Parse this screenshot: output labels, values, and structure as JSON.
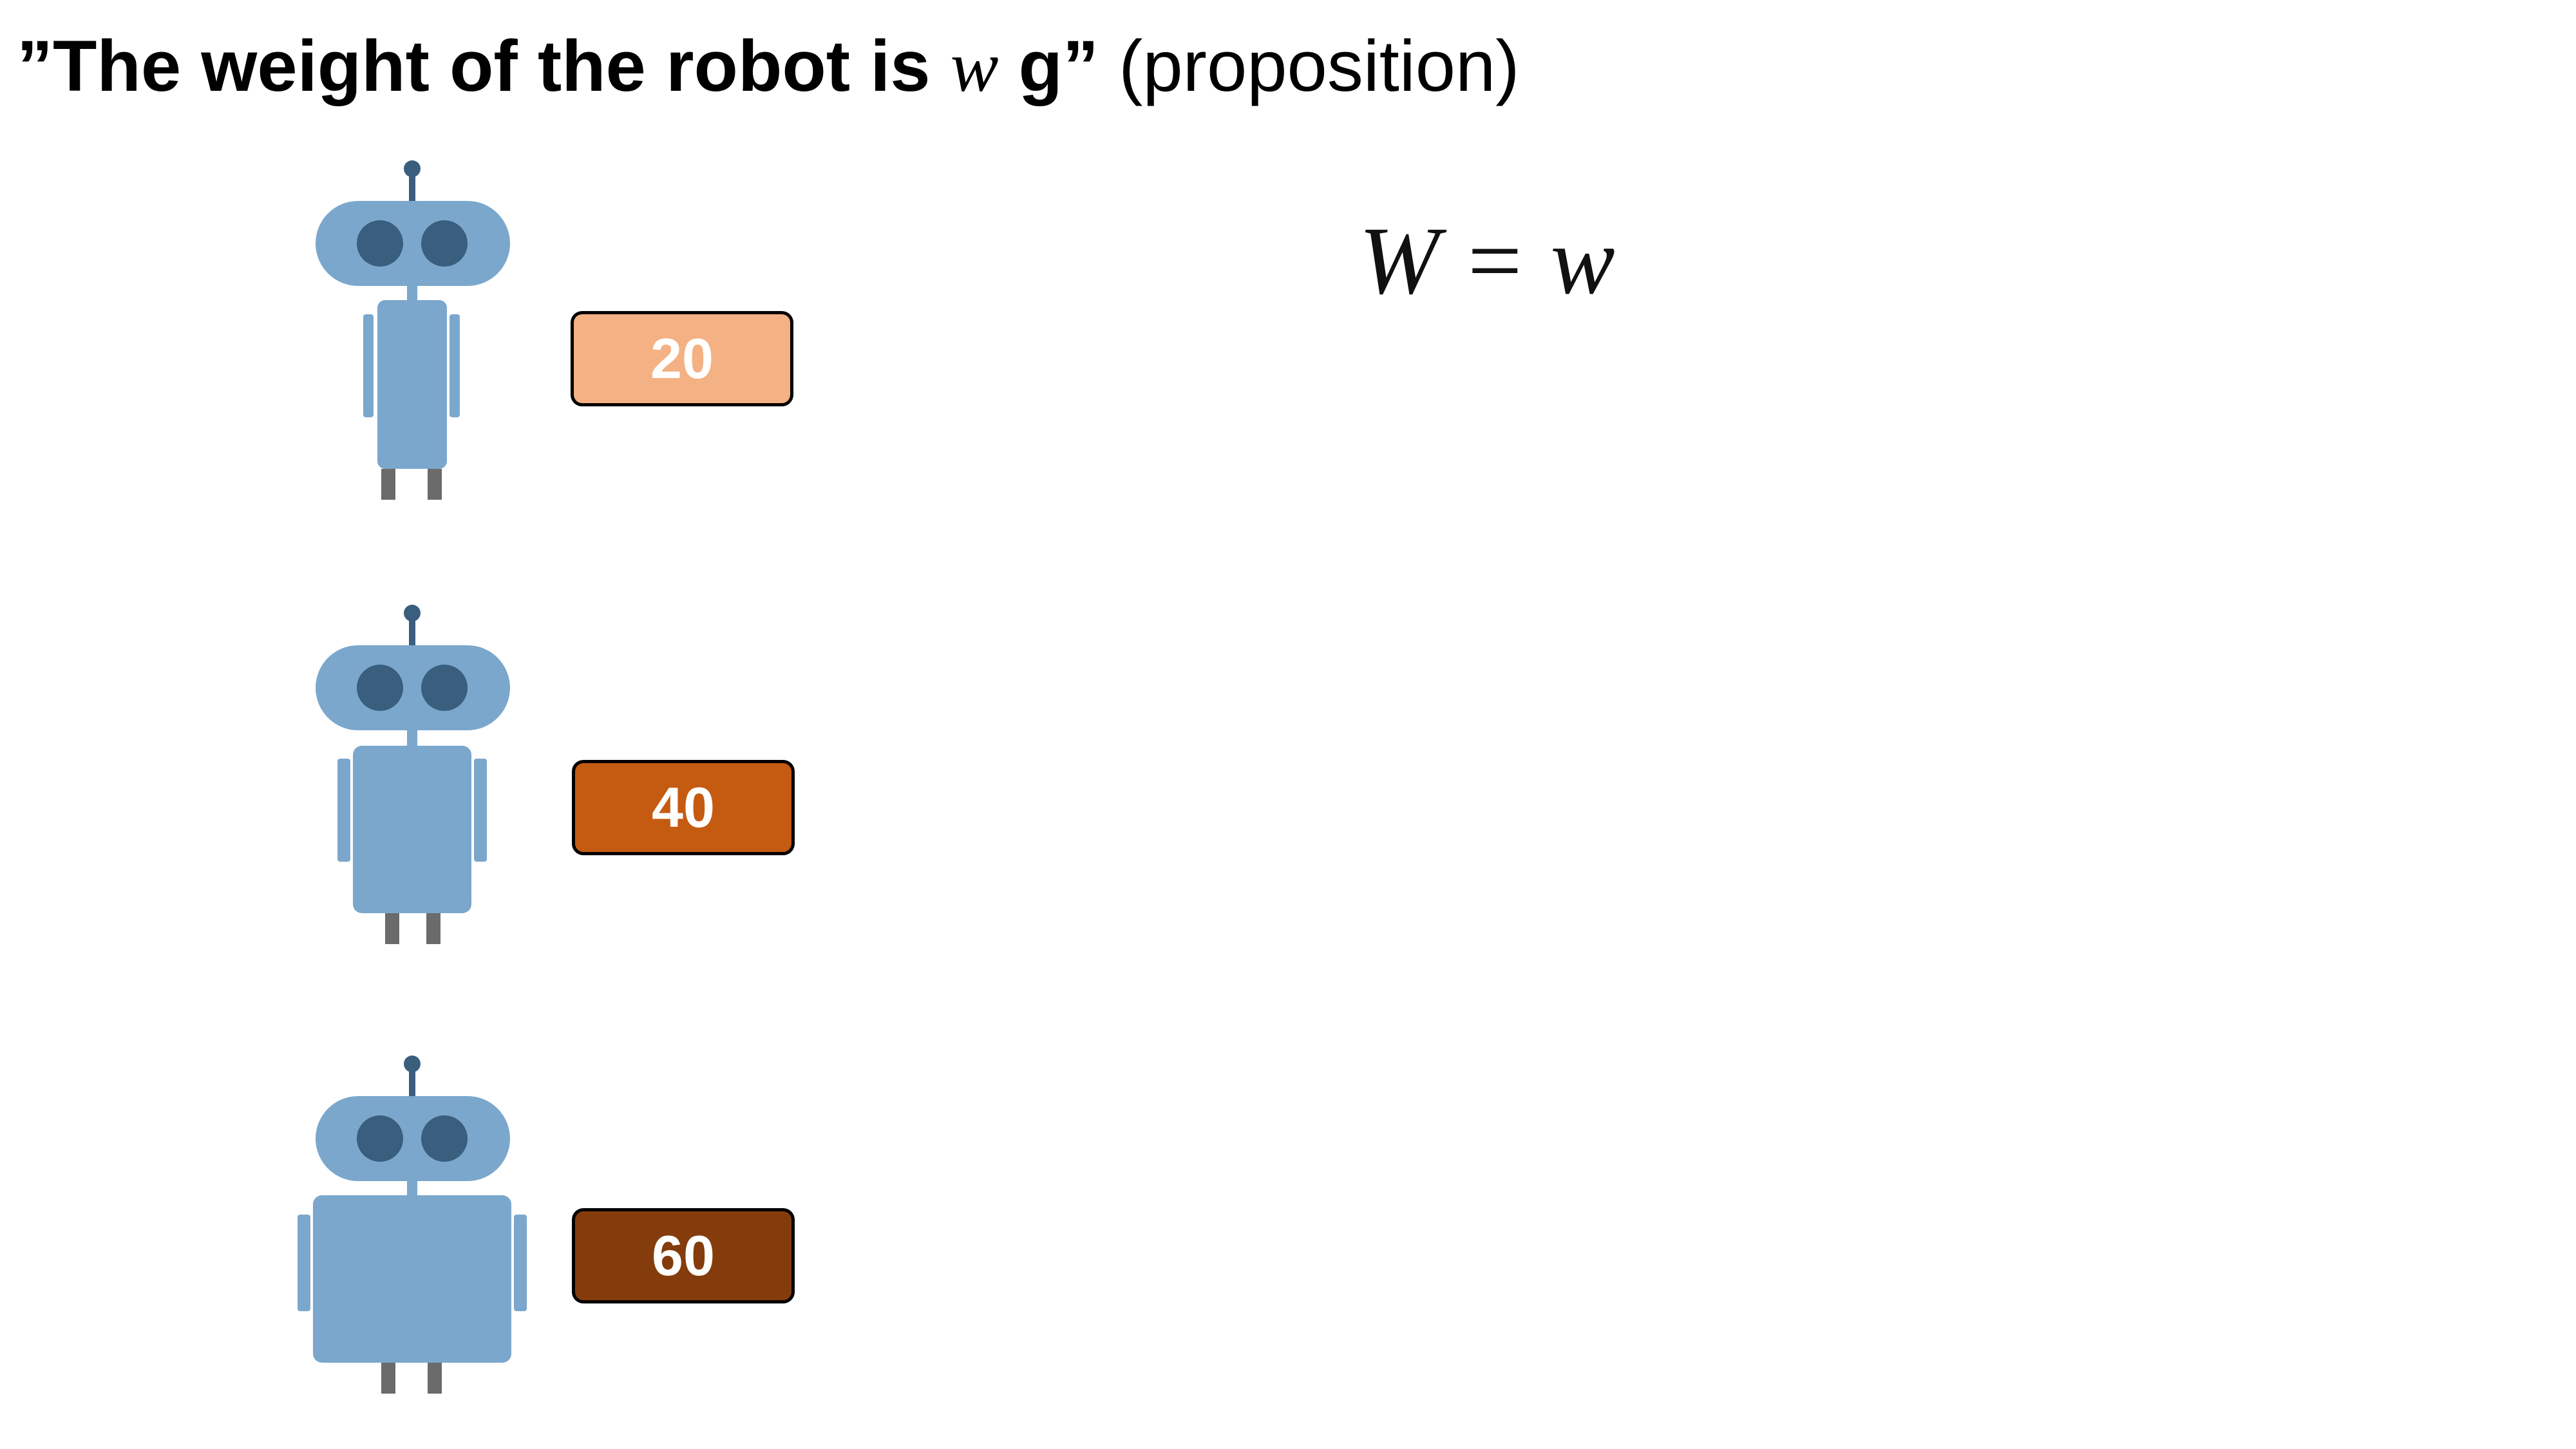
{
  "title": {
    "open_quote": "”",
    "main_text": "The weight of the robot is ",
    "variable": "w",
    "unit_text": " g",
    "close_quote": "”",
    "suffix": " (proposition)"
  },
  "equation": {
    "lhs": "W",
    "operator": "=",
    "rhs": "w"
  },
  "robots": [
    {
      "weight_label": "20",
      "size": "small",
      "box_color": "#F4B183"
    },
    {
      "weight_label": "40",
      "size": "medium",
      "box_color": "#C55A11"
    },
    {
      "weight_label": "60",
      "size": "large",
      "box_color": "#843C0C"
    }
  ],
  "colors": {
    "robot_body": "#7BA7CC",
    "robot_eyes": "#3A5E7D",
    "robot_legs": "#6B6B6B"
  }
}
